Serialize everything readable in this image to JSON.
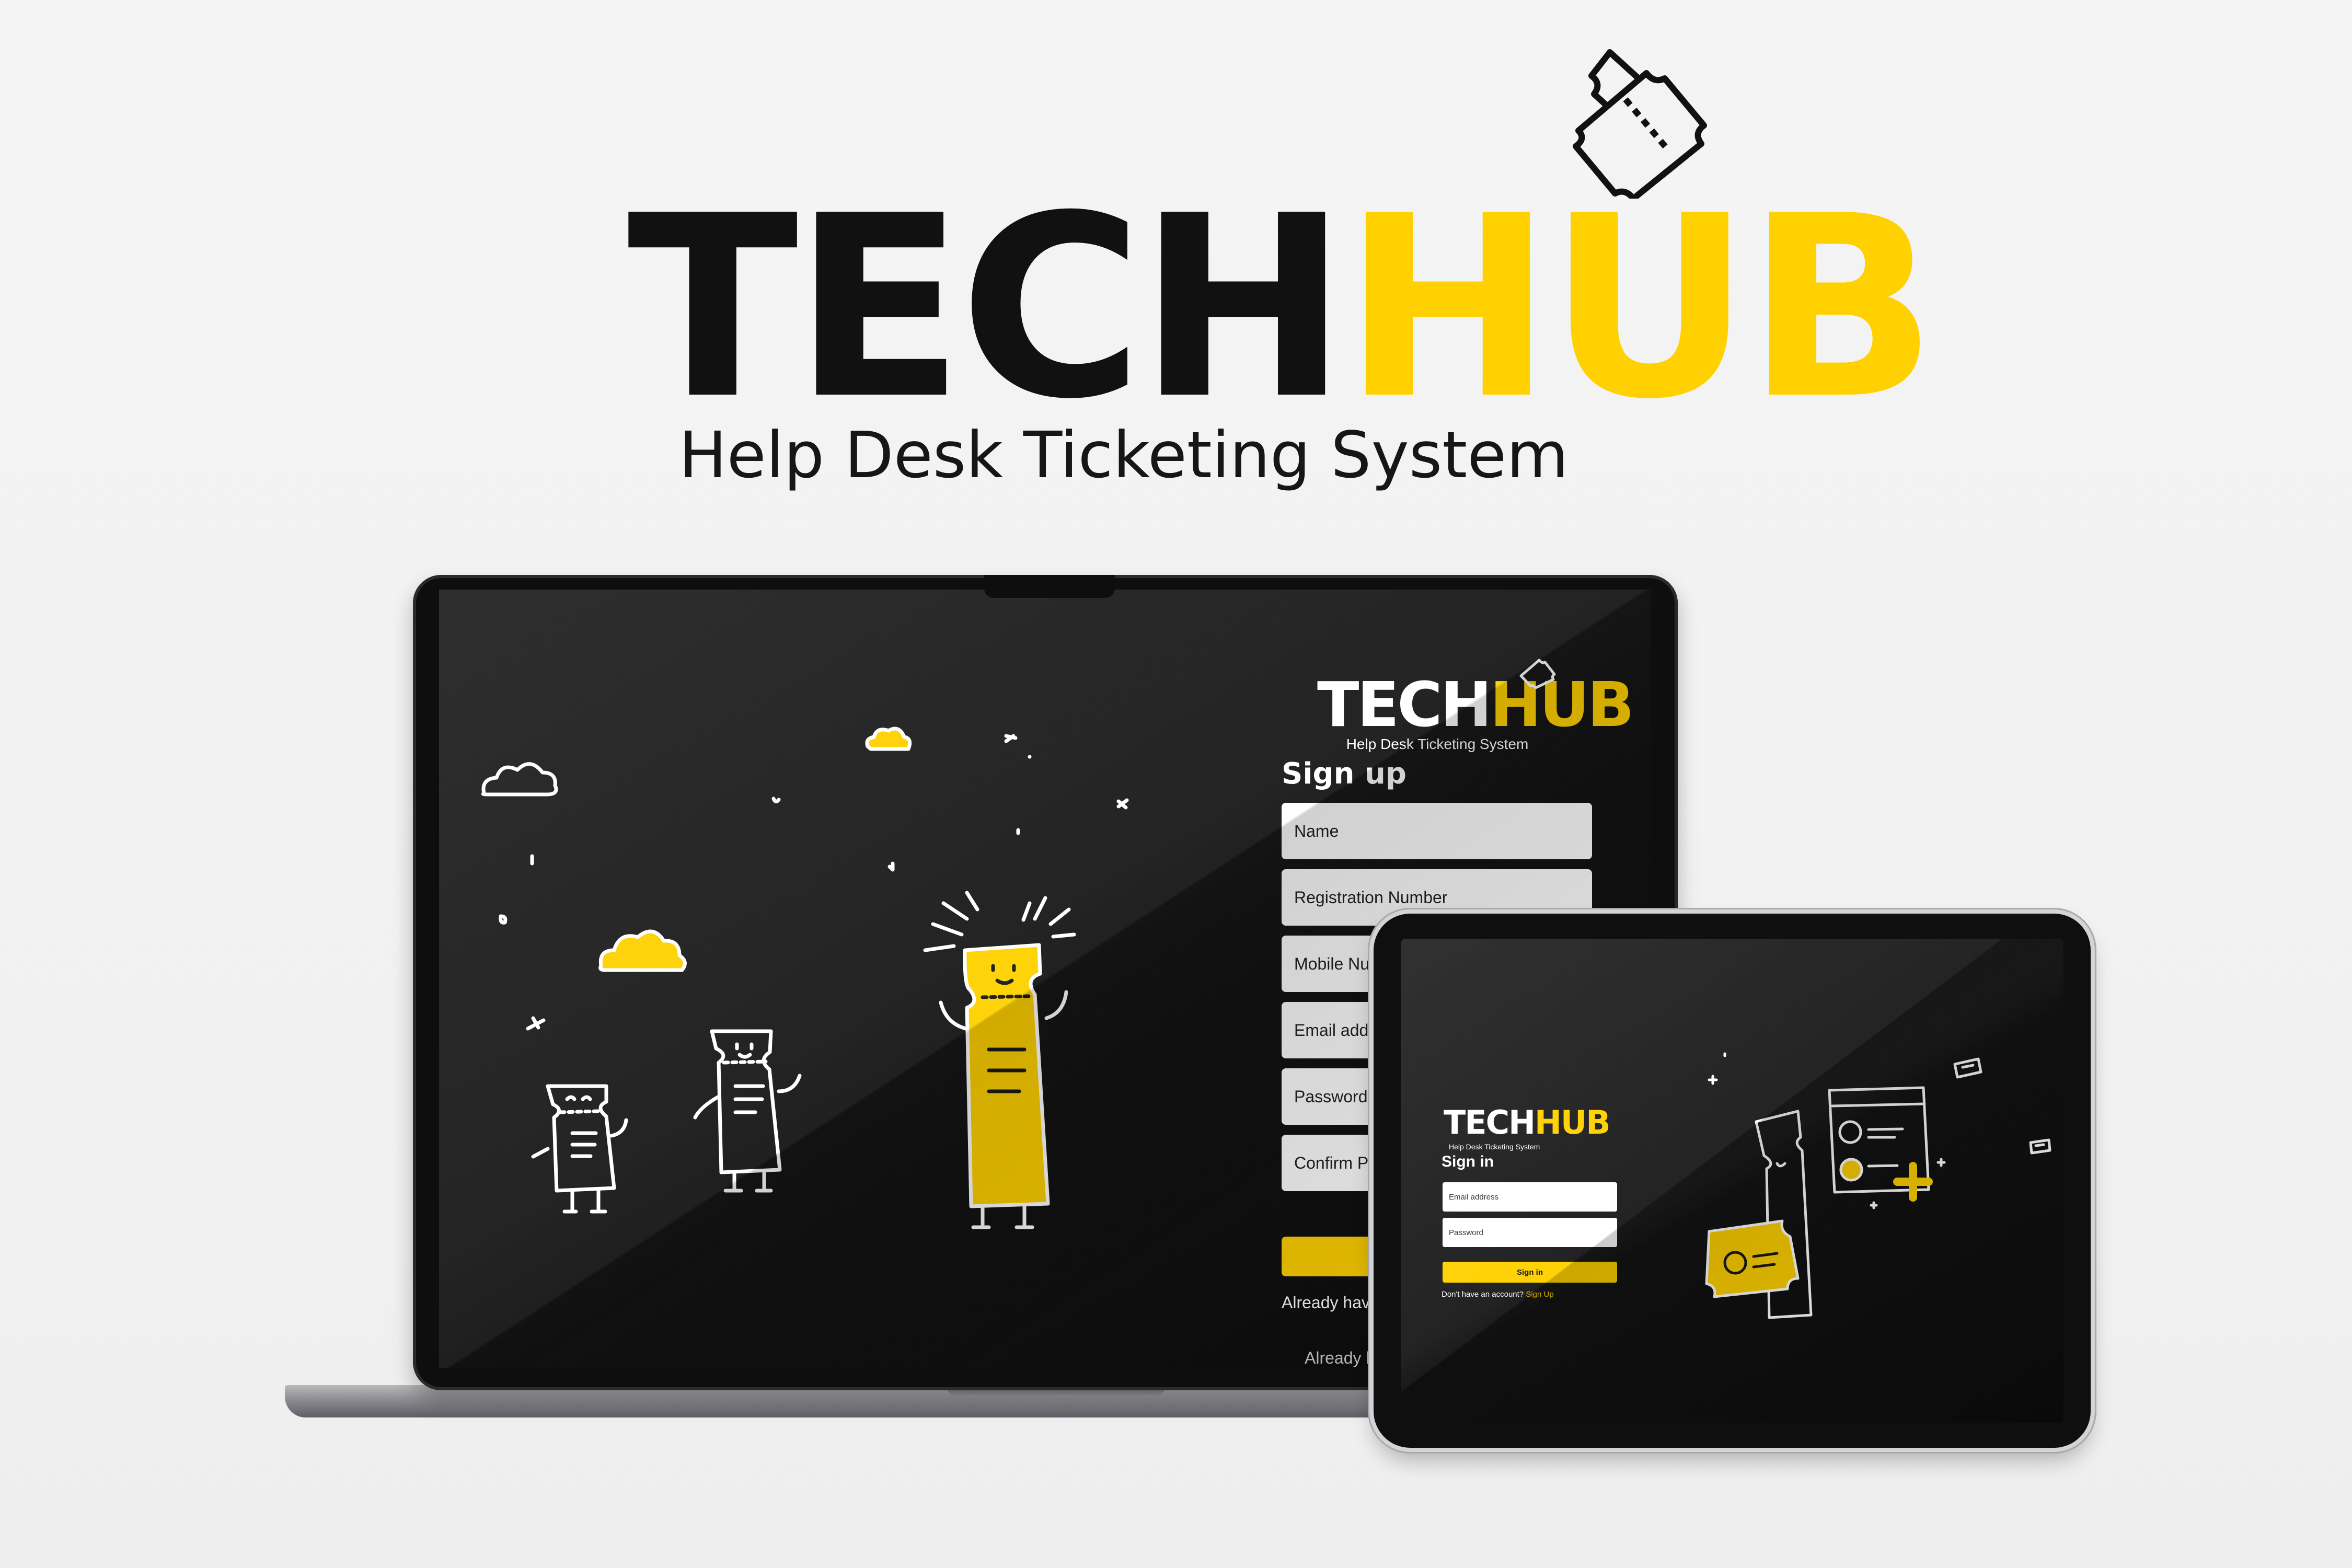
{
  "brand": {
    "name_part1": "TECH",
    "name_part2": "HUB",
    "tagline": "Help Desk Ticketing System",
    "colors": {
      "accent": "#ffd100",
      "dark": "#111111",
      "screen": "#1a1a1a"
    },
    "icon": "ticket-icon"
  },
  "laptop": {
    "logo_part1": "TECH",
    "logo_part2": "HUB",
    "tagline": "Help Desk Ticketing System",
    "title": "Sign up",
    "fields": [
      {
        "placeholder": "Name"
      },
      {
        "placeholder": "Registration Number"
      },
      {
        "placeholder": "Mobile Nu"
      },
      {
        "placeholder": "Email add"
      },
      {
        "placeholder": "Password"
      },
      {
        "placeholder": "Confirm P"
      }
    ],
    "already_text_1": "Already hav",
    "already_text_2": "Already h"
  },
  "tablet": {
    "logo_part1": "TECH",
    "logo_part2": "HUB",
    "tagline": "Help Desk Ticketing System",
    "title": "Sign in",
    "fields": [
      {
        "placeholder": "Email address"
      },
      {
        "placeholder": "Password"
      }
    ],
    "button_label": "Sign in",
    "footer_text": "Don't have an account?",
    "footer_link": "Sign Up"
  }
}
